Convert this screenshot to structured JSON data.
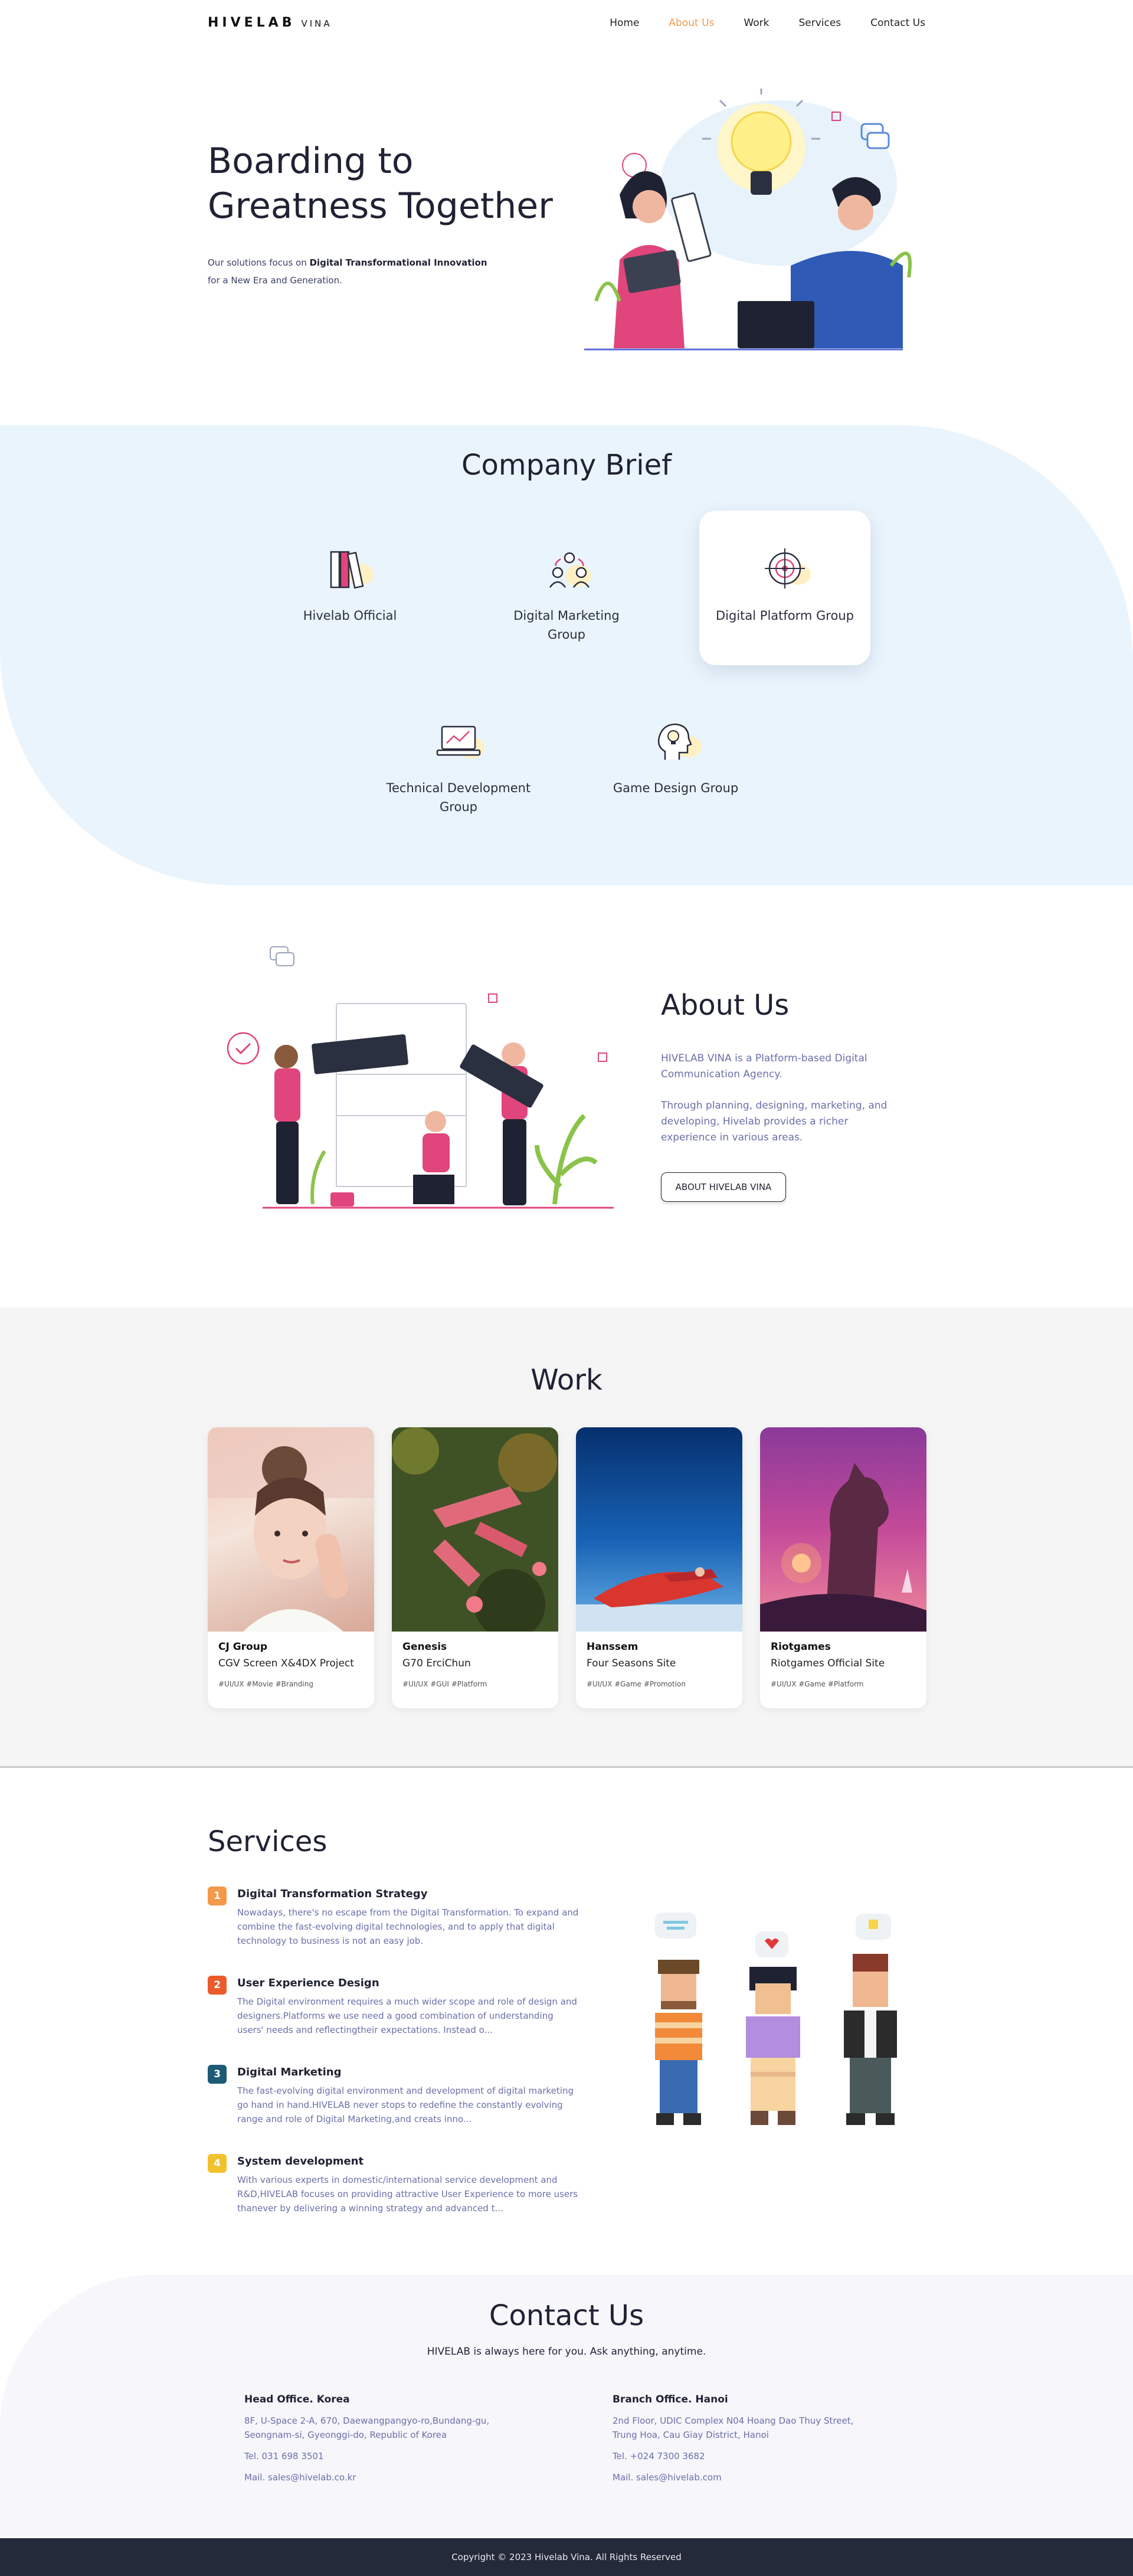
{
  "header": {
    "logo_main": "HIVELAB",
    "logo_sub": "VINA",
    "nav": [
      "Home",
      "About Us",
      "Work",
      "Services",
      "Contact Us"
    ],
    "active_nav": "About Us",
    "accent_color": "#f2994a"
  },
  "hero": {
    "title_line1": "Boarding to",
    "title_line2": "Greatness Together",
    "desc_prefix": "Our solutions focus on ",
    "desc_bold": "Digital Transformational Innovation",
    "desc_line2": "for a New Era and Generation."
  },
  "brief": {
    "title": "Company Brief",
    "items": [
      {
        "label": "Hivelab Official",
        "icon": "books-icon"
      },
      {
        "label": "Digital Marketing Group",
        "icon": "people-network-icon"
      },
      {
        "label": "Digital Platform Group",
        "icon": "target-icon"
      },
      {
        "label": "Technical Development Group",
        "icon": "laptop-chart-icon"
      },
      {
        "label": "Game Design Group",
        "icon": "head-bulb-icon"
      }
    ],
    "background_color": "#eaf4fc"
  },
  "about": {
    "title": "About Us",
    "p1": "HIVELAB VINA is a Platform-based Digital Communication Agency.",
    "p2": "Through planning, designing, marketing, and developing, Hivelab provides a richer experience in various areas.",
    "button": "ABOUT HIVELAB VINA"
  },
  "work": {
    "title": "Work",
    "cards": [
      {
        "client": "CJ Group",
        "project": "CGV Screen X&4DX Project",
        "tags": "#UI/UX #Movie #Branding"
      },
      {
        "client": "Genesis",
        "project": "G70 ErciChun",
        "tags": "#UI/UX #GUI #Platform"
      },
      {
        "client": "Hanssem",
        "project": "Four Seasons Site",
        "tags": "#UI/UX #Game #Promotion"
      },
      {
        "client": "Riotgames",
        "project": "Riotgames Official Site",
        "tags": "#UI/UX #Game #Platform"
      }
    ]
  },
  "services": {
    "title": "Services",
    "items": [
      {
        "num": "1",
        "color": "#f2994a",
        "name": "Digital Transformation Strategy",
        "desc": "Nowadays, there's no escape from the Digital Transformation. To expand and combine the fast-evolving digital technologies, and to apply that digital technology to business is not an easy job."
      },
      {
        "num": "2",
        "color": "#eb5a2b",
        "name": "User Experience Design",
        "desc": "The Digital environment requires a much wider scope and role of design and designers.Platforms we use need a good combination of understanding users' needs and reflectingtheir expectations. Instead o..."
      },
      {
        "num": "3",
        "color": "#1d5b75",
        "name": "Digital Marketing",
        "desc": "The fast-evolving digital environment and development of digital marketing go hand in hand.HIVELAB never stops to redefine the constantly evolving range and role of Digital Marketing,and creats inno..."
      },
      {
        "num": "4",
        "color": "#f2c12e",
        "name": "System development",
        "desc": "With various experts in domestic/international service development and R&D,HIVELAB focuses on providing attractive User Experience to more users thanever by delivering a winning strategy and advanced t..."
      }
    ]
  },
  "contact": {
    "title": "Contact Us",
    "subtitle": "HIVELAB is always here for you. Ask anything, anytime.",
    "offices": [
      {
        "name": "Head Office. Korea",
        "addr1": "8F, U-Space 2-A, 670, Daewangpangyo-ro,Bundang-gu,",
        "addr2": "Seongnam-si, Gyeonggi-do, Republic of Korea",
        "tel": "Tel. 031 698 3501",
        "mail": "Mail. sales@hivelab.co.kr"
      },
      {
        "name": "Branch Office. Hanoi",
        "addr1": "2nd Floor, UDIC Complex N04 Hoang Dao Thuy Street,",
        "addr2": "Trung Hoa, Cau Giay District, Hanoi",
        "tel": "Tel. +024 7300 3682",
        "mail": "Mail. sales@hivelab.com"
      }
    ]
  },
  "footer": {
    "copyright": "Copyright © 2023 Hivelab Vina. All Rights Reserved"
  }
}
